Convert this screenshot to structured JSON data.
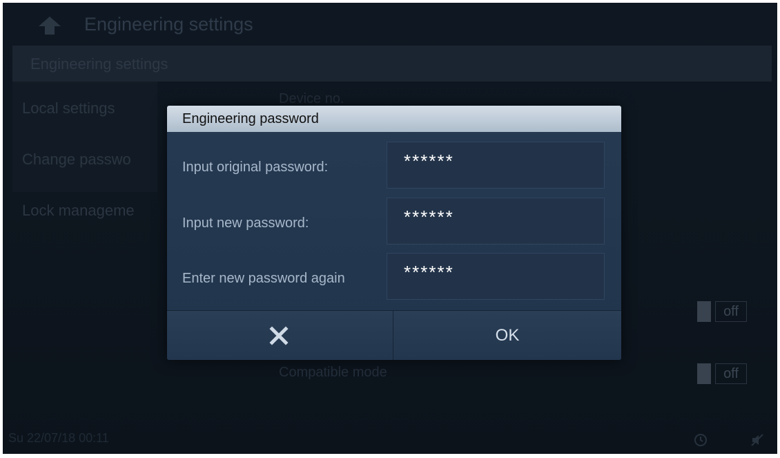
{
  "app": {
    "title": "Engineering settings",
    "section_title": "Engineering settings"
  },
  "sidebar": {
    "items": [
      {
        "label": "Local settings"
      },
      {
        "label": "Change passwo"
      },
      {
        "label": "Lock manageme"
      }
    ]
  },
  "background_fields": {
    "device_no_label": "Device no.",
    "compatible_mode_label": "Compatible mode",
    "toggle_1": "off",
    "toggle_2": "off"
  },
  "status": {
    "datetime": "Su 22/07/18  00:11",
    "icons": [
      "clock-icon",
      "mute-icon"
    ]
  },
  "dialog": {
    "title": "Engineering password",
    "rows": [
      {
        "label": "Input original password:",
        "value": "******"
      },
      {
        "label": "Input new password:",
        "value": "******"
      },
      {
        "label": "Enter new password again",
        "value": "******"
      }
    ],
    "cancel_icon": "close-icon",
    "ok_label": "OK"
  },
  "colors": {
    "screen_bg": "#0f1822",
    "dialog_bg": "#263a52",
    "dialog_header": "#c4d0dc",
    "label_text": "#a7b8ca"
  }
}
